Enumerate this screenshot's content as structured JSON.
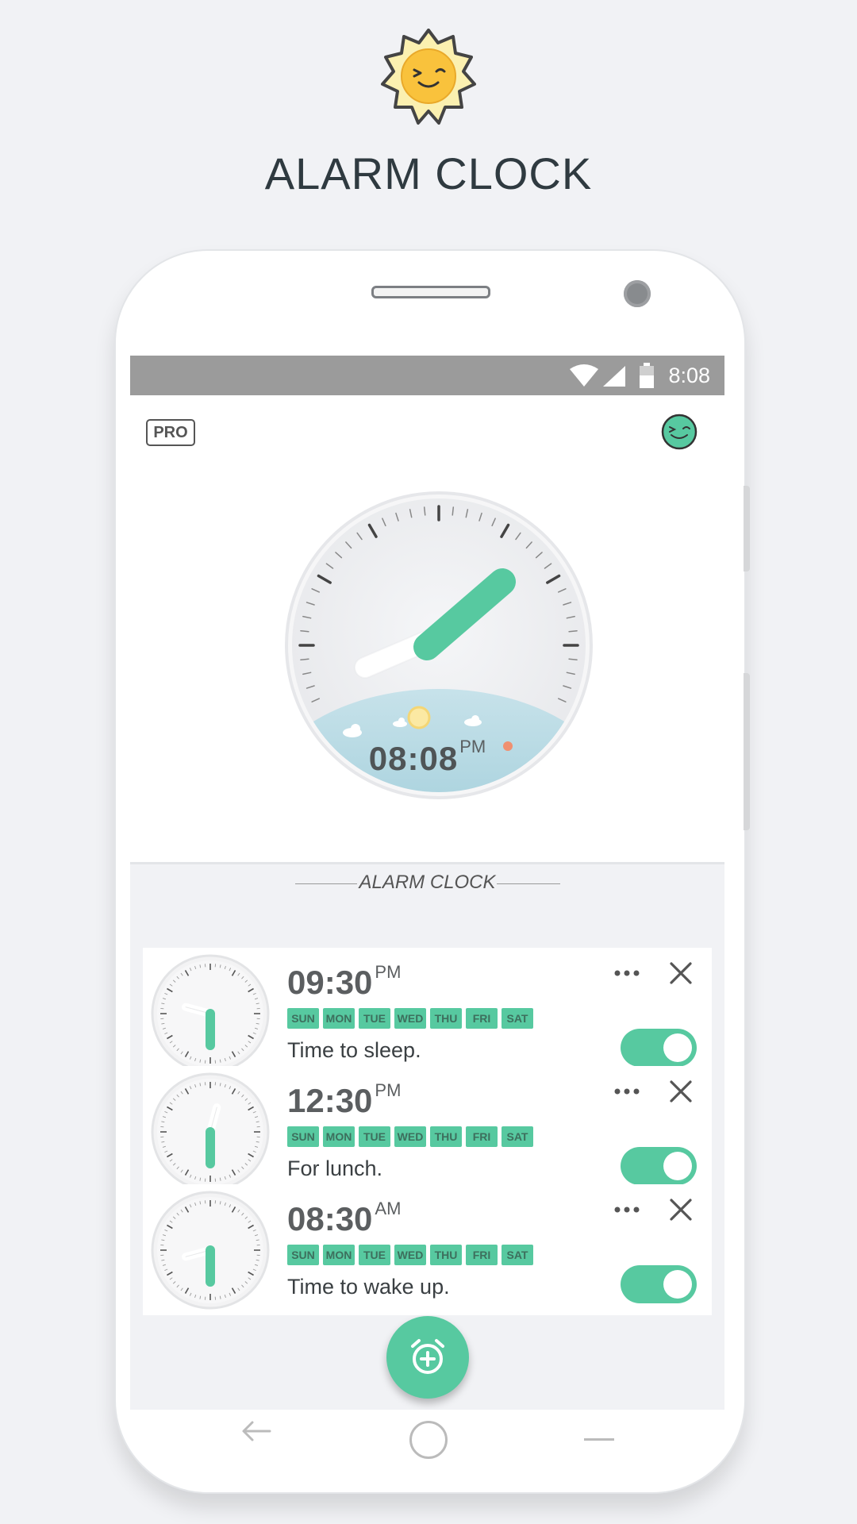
{
  "header": {
    "title": "ALARM CLOCK",
    "logo_icon": "sun-smiley-logo-icon"
  },
  "statusbar": {
    "time": "8:08",
    "icons": [
      "wifi-icon",
      "signal-icon",
      "battery-icon"
    ]
  },
  "topbar": {
    "pro_label": "PRO",
    "profile_icon": "smiley-face-icon"
  },
  "main_clock": {
    "time": "08:08",
    "ampm": "PM"
  },
  "section": {
    "title": "ALARM CLOCK"
  },
  "alarms": [
    {
      "time": "09:30",
      "ampm": "PM",
      "days": [
        "SUN",
        "MON",
        "TUE",
        "WED",
        "THU",
        "FRI",
        "SAT"
      ],
      "label": "Time to sleep.",
      "enabled": true
    },
    {
      "time": "12:30",
      "ampm": "PM",
      "days": [
        "SUN",
        "MON",
        "TUE",
        "WED",
        "THU",
        "FRI",
        "SAT"
      ],
      "label": "For lunch.",
      "enabled": true
    },
    {
      "time": "08:30",
      "ampm": "AM",
      "days": [
        "SUN",
        "MON",
        "TUE",
        "WED",
        "THU",
        "FRI",
        "SAT"
      ],
      "label": "Time to wake up.",
      "enabled": true
    }
  ],
  "fab": {
    "icon": "add-alarm-icon"
  },
  "colors": {
    "accent": "#57c9a0",
    "status_bar": "#9b9b9b",
    "background": "#f1f2f5"
  }
}
